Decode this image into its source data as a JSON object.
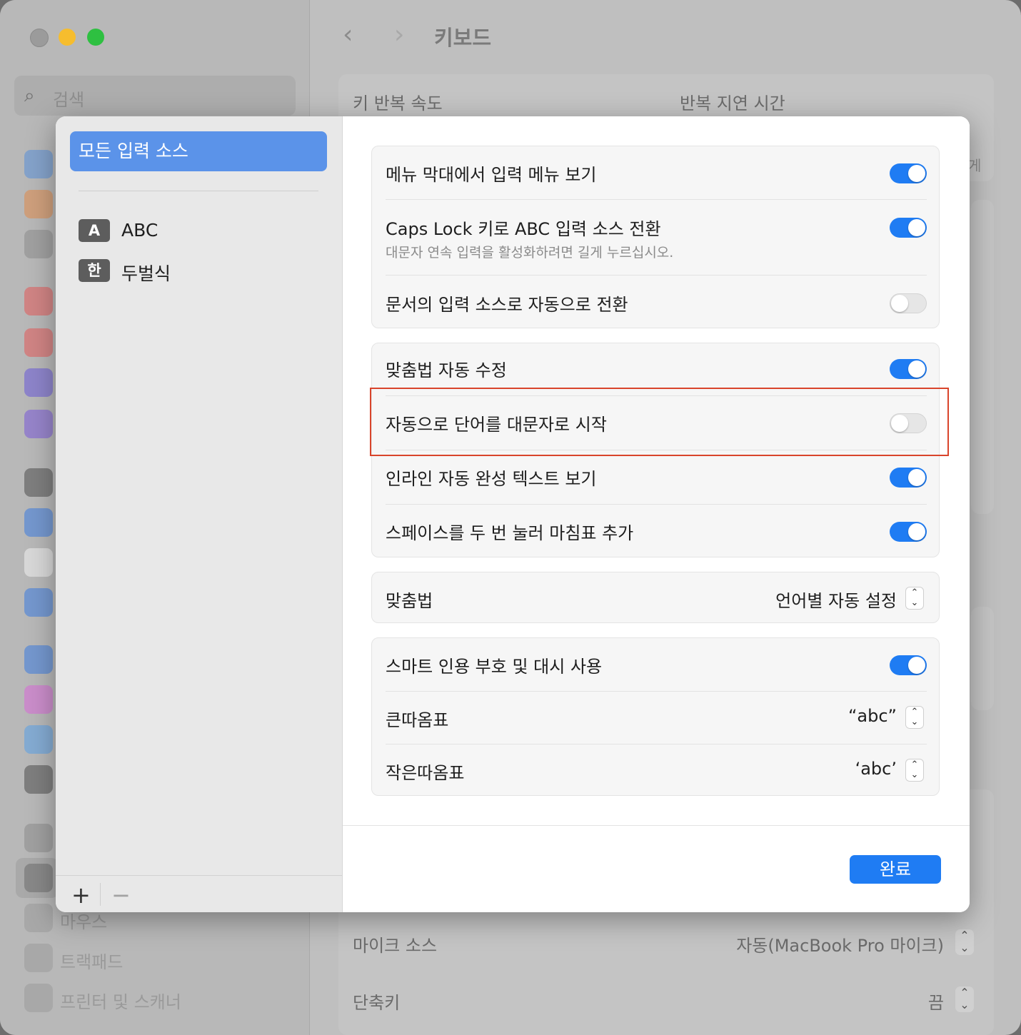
{
  "window": {
    "search_placeholder": "검색",
    "title": "키보드",
    "sidebar_items": [
      {
        "label": "마우스",
        "icon": "mouse-icon"
      },
      {
        "label": "트랙패드",
        "icon": "trackpad-icon"
      },
      {
        "label": "프린터 및 스캐너",
        "icon": "printer-icon"
      }
    ],
    "settings": {
      "key_repeat_rate": "키 반복 속도",
      "repeat_delay": "반복 지연 시간",
      "mic_source_label": "마이크 소스",
      "mic_source_value": "자동(MacBook Pro 마이크)",
      "shortcut_label": "단축키",
      "shortcut_value": "끔",
      "clipped_text": "게"
    }
  },
  "sheet": {
    "input_sources": {
      "all_label": "모든 입력 소스",
      "items": [
        {
          "badge": "A",
          "label": "ABC"
        },
        {
          "badge": "한",
          "label": "두벌식"
        }
      ],
      "add_label": "+",
      "remove_label": "−"
    },
    "groups": {
      "menu": [
        {
          "label": "메뉴 막대에서 입력 메뉴 보기",
          "on": true
        },
        {
          "label": "Caps Lock 키로 ABC 입력 소스 전환",
          "sub": "대문자 연속 입력을 활성화하려면 길게 누르십시오.",
          "on": true
        },
        {
          "label": "문서의 입력 소스로 자동으로 전환",
          "on": false
        }
      ],
      "autocorrect": [
        {
          "label": "맞춤법 자동 수정",
          "on": true
        },
        {
          "label": "자동으로 단어를 대문자로 시작",
          "on": false
        },
        {
          "label": "인라인 자동 완성 텍스트 보기",
          "on": true
        },
        {
          "label": "스페이스를 두 번 눌러 마침표 추가",
          "on": true
        }
      ],
      "spelling": {
        "label": "맞춤법",
        "value": "언어별 자동 설정"
      },
      "quotes": {
        "smart": {
          "label": "스마트 인용 부호 및 대시 사용",
          "on": true
        },
        "double": {
          "label": "큰따옴표",
          "value": "“abc”"
        },
        "single": {
          "label": "작은따옴표",
          "value": "‘abc’"
        }
      }
    },
    "done_label": "완료"
  },
  "colors": {
    "accent": "#1f7cf3",
    "selection": "#5b93e9",
    "highlight_box": "#d9442b"
  }
}
